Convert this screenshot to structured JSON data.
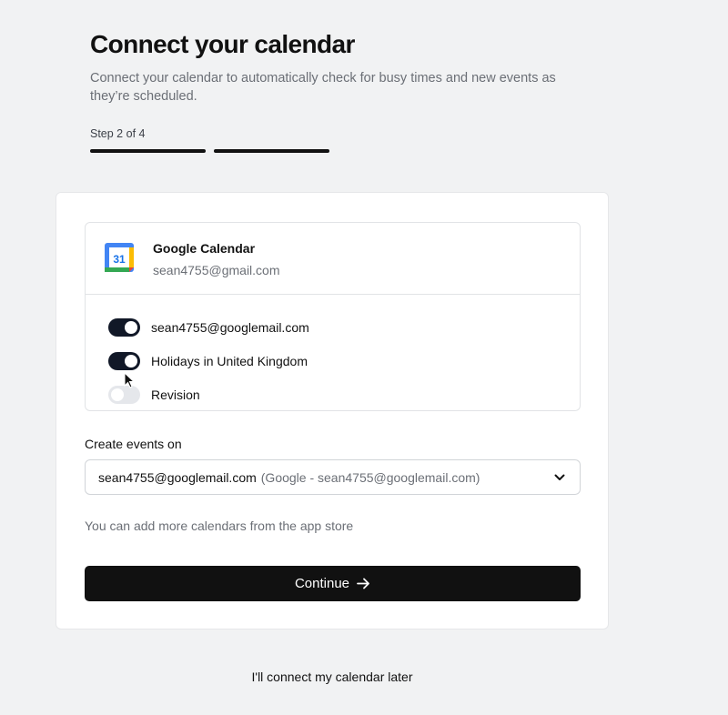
{
  "header": {
    "title": "Connect your calendar",
    "subtitle": "Connect your calendar to automatically check for busy times and new events as they’re scheduled.",
    "step_label": "Step 2 of 4"
  },
  "integration": {
    "name": "Google Calendar",
    "email": "sean4755@gmail.com",
    "icon": "google-calendar-icon",
    "calendars": [
      {
        "label": "sean4755@googlemail.com",
        "enabled": true
      },
      {
        "label": "Holidays in United Kingdom",
        "enabled": true
      },
      {
        "label": "Revision",
        "enabled": false
      }
    ]
  },
  "create_events": {
    "label": "Create events on",
    "selected": "sean4755@googlemail.com",
    "selected_detail": "(Google - sean4755@googlemail.com)"
  },
  "helper_text": "You can add more calendars from the app store",
  "continue_label": "Continue",
  "later_label": "I'll connect my calendar later",
  "colors": {
    "background": "#f1f2f3",
    "primary": "#111111",
    "toggle_on": "#111827",
    "toggle_off": "#e5e7eb",
    "muted_text": "#6b6f76"
  }
}
